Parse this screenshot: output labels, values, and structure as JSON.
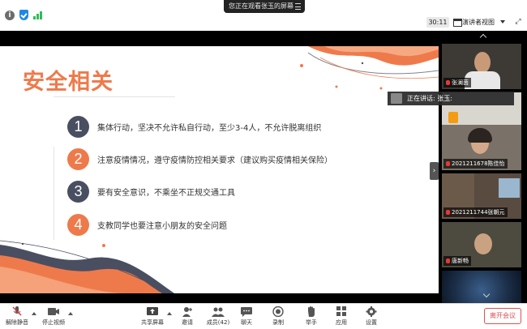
{
  "topbar": {
    "share_banner": "您正在观看张玉的屏幕",
    "timer": "30:11",
    "view_label": "演讲者视图"
  },
  "slide": {
    "title": "安全相关",
    "items": [
      {
        "num": "1",
        "text": "集体行动，坚决不允许私自行动，至少3-4人，不允许脱离组织"
      },
      {
        "num": "2",
        "text": "注意疫情情况，遵守疫情防控相关要求（建议购买疫情相关保险）"
      },
      {
        "num": "3",
        "text": "要有安全意识，不乘坐不正规交通工具"
      },
      {
        "num": "4",
        "text": "支教同学也要注意小朋友的安全问题"
      }
    ]
  },
  "speaking": {
    "label": "正在讲话: 张玉:"
  },
  "gallery": {
    "participants": [
      {
        "name": "张澜茵"
      },
      {
        "name": "张玉"
      },
      {
        "name": "2021211678陈佳怡"
      },
      {
        "name": "2021211744张朝元"
      },
      {
        "name": "唐新畅"
      }
    ]
  },
  "toolbar": {
    "unmute": "解除静音",
    "stop_video": "停止视频",
    "share_screen": "共享屏幕",
    "invite": "邀请",
    "participants": "成员(42)",
    "chat": "聊天",
    "record": "录制",
    "raise_hand": "举手",
    "apps": "应用",
    "settings": "设置",
    "leave": "离开会议"
  },
  "colors": {
    "accent_orange": "#ee7a4b",
    "number_dark": "#4a4e61",
    "leave_red": "#d9534f"
  }
}
